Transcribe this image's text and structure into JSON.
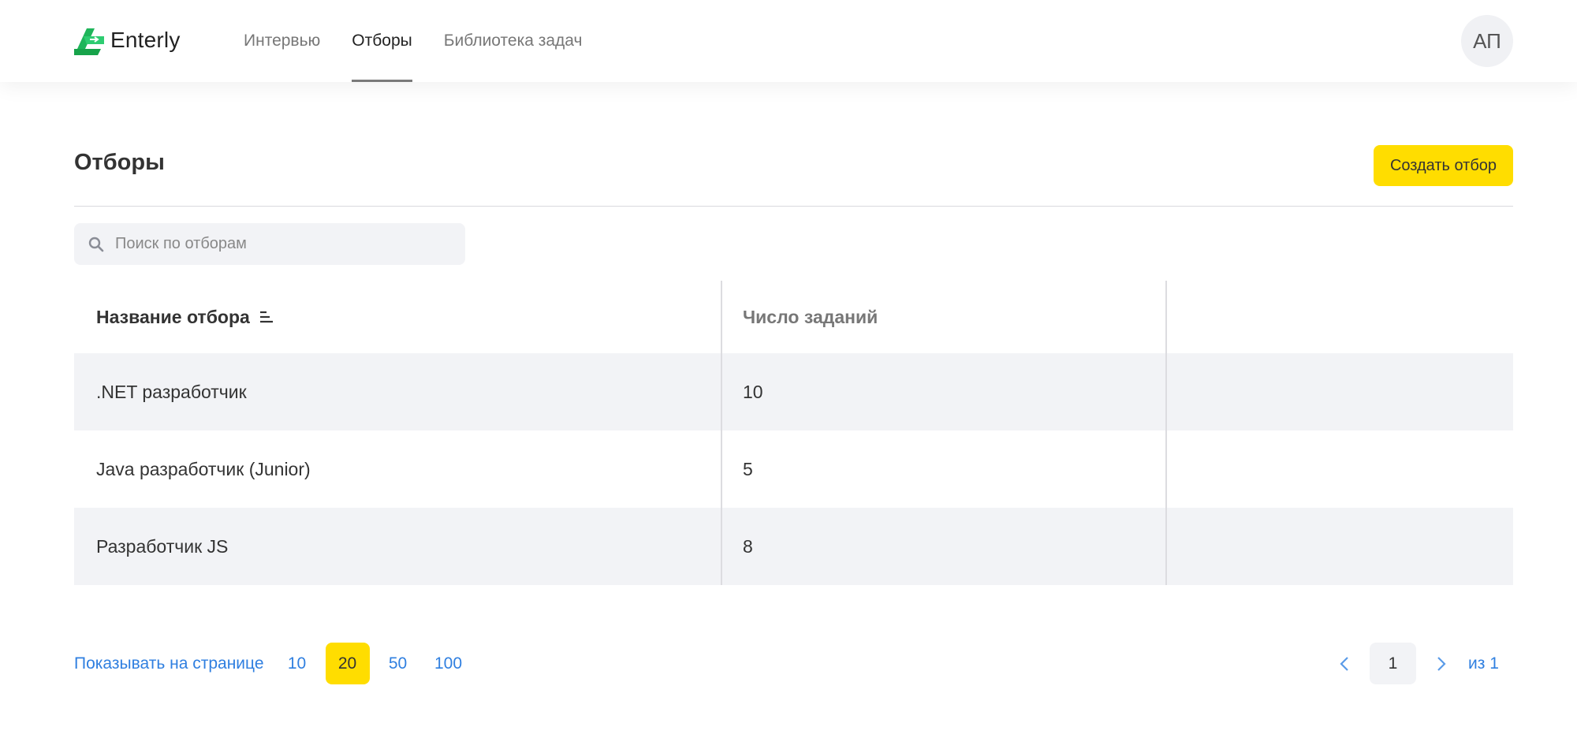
{
  "header": {
    "brand": "Enterly",
    "nav": [
      {
        "label": "Интервью"
      },
      {
        "label": "Отборы",
        "active": true
      },
      {
        "label": "Библиотека задач"
      }
    ],
    "avatar_initials": "АП"
  },
  "page": {
    "title": "Отборы",
    "create_button": "Создать отбор"
  },
  "search": {
    "placeholder": "Поиск по отборам",
    "value": ""
  },
  "table": {
    "columns": [
      "Название отбора",
      "Число заданий",
      ""
    ],
    "rows": [
      {
        "name": ".NET разработчик",
        "count": "10"
      },
      {
        "name": "Java разработчик (Junior)",
        "count": "5"
      },
      {
        "name": "Разработчик JS",
        "count": "8"
      }
    ]
  },
  "pagination": {
    "per_page_label": "Показывать на странице",
    "per_page_options": [
      "10",
      "20",
      "50",
      "100"
    ],
    "per_page_selected": "20",
    "current_page": "1",
    "total_label": "из 1"
  },
  "colors": {
    "brand_green": "#1fb55a",
    "accent_yellow": "#ffdd00",
    "link_blue": "#2f7fe0"
  }
}
